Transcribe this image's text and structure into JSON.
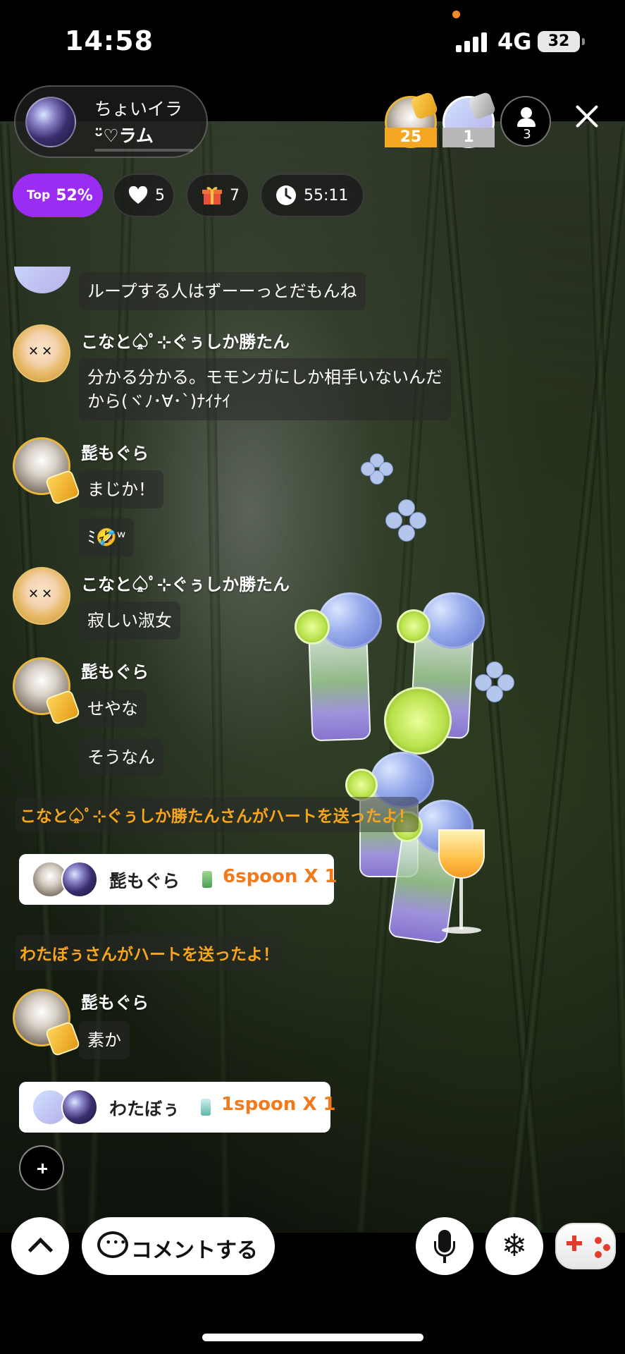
{
  "status_bar": {
    "time": "14:58",
    "network": "4G",
    "battery": "32"
  },
  "host": {
    "name_line1": "ちょいイラ",
    "name_line2": "ᵕ̈♡ラム"
  },
  "top_listeners": [
    {
      "badge": "25",
      "badge_color": "#f5a623"
    },
    {
      "badge": "1",
      "badge_color": "#b8b8b8"
    }
  ],
  "listener_count": "3",
  "stats": {
    "top_label": "Top",
    "top_value": "52%",
    "likes": "5",
    "gifts": "7",
    "duration": "55:11"
  },
  "chat": {
    "msg0": {
      "text": "ループする人はずーーっとだもんね"
    },
    "msg1": {
      "user": "こなと♤ﾟ⊹ぐぅしか勝たん",
      "line1": "分かる分かる。モモンガにしか相手いないんだ",
      "line2": "から(ヾﾉ･∀･`)ﾅｲﾅｲ"
    },
    "msg2": {
      "user": "髭もぐら",
      "text1": "まじか！",
      "text2": "ﾐ🤣ʷ"
    },
    "msg3": {
      "user": "こなと♤ﾟ⊹ぐぅしか勝たん",
      "text": "寂しい淑女"
    },
    "msg4": {
      "user": "髭もぐら",
      "text1": "せやな",
      "text2": "そうなん"
    },
    "system1": "こなと♤ﾟ⊹ぐぅしか勝たんさんがハートを送ったよ！",
    "gift1": {
      "user": "髭もぐら",
      "amount": "6spoon X 1"
    },
    "system2": "わたぼぅさんがハートを送ったよ！",
    "msg5": {
      "user": "髭もぐら",
      "text": "素か"
    },
    "gift2": {
      "user": "わたぼぅ",
      "amount": "1spoon X 1"
    }
  },
  "bottom_bar": {
    "comment_label": "コメントする"
  },
  "colors": {
    "top_pill": "#9b2df2",
    "system_text": "#f7a51c",
    "gift_amount": "#f07a1c"
  },
  "icons": [
    "heart-icon",
    "gift-icon",
    "clock-icon",
    "close-icon",
    "person-icon",
    "chevron-up-icon",
    "chat-bubble-icon",
    "microphone-icon",
    "snowflake-icon",
    "game-controller-icon",
    "plus-icon"
  ]
}
